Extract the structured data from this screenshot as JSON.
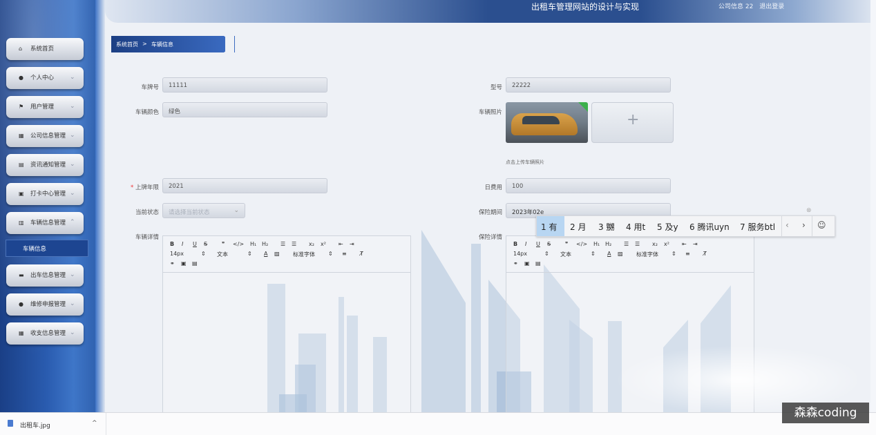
{
  "header": {
    "title": "出租车管理网站的设计与实现",
    "company_info": "公司信息 22",
    "logout": "退出登录"
  },
  "sidebar": {
    "items": [
      {
        "label": "系统首页",
        "icon": "home-icon",
        "glyph": "⌂"
      },
      {
        "label": "个人中心",
        "icon": "user-icon",
        "glyph": "●"
      },
      {
        "label": "用户管理",
        "icon": "flag-icon",
        "glyph": "⚑"
      },
      {
        "label": "公司信息管理",
        "icon": "grid-icon",
        "glyph": "▦"
      },
      {
        "label": "资讯通知管理",
        "icon": "news-icon",
        "glyph": "▤"
      },
      {
        "label": "打卡中心管理",
        "icon": "printer-icon",
        "glyph": "▣"
      },
      {
        "label": "车辆信息管理",
        "icon": "doc-icon",
        "glyph": "▥"
      },
      {
        "label": "出车信息管理",
        "icon": "monitor-icon",
        "glyph": "▬"
      },
      {
        "label": "维修申报管理",
        "icon": "user-icon",
        "glyph": "●"
      },
      {
        "label": "收支信息管理",
        "icon": "grid-icon",
        "glyph": "▦"
      }
    ],
    "active_sub": "车辆信息"
  },
  "breadcrumb": {
    "home": "系统首页",
    "sep": ">",
    "current": "车辆信息"
  },
  "form": {
    "plate_label": "车牌号",
    "plate_value": "11111",
    "model_label": "型号",
    "model_value": "22222",
    "color_label": "车辆颜色",
    "color_value": "绿色",
    "photo_label": "车辆照片",
    "photo_hint": "点击上传车辆照片",
    "upload_plus": "+",
    "year_required": "*",
    "year_label": "上牌年限",
    "year_value": "2021",
    "fee_label": "日费用",
    "fee_value": "100",
    "status_label": "当前状态",
    "status_placeholder": "请选择当前状态",
    "insurance_label": "保险期间",
    "insurance_value": "2023年02e",
    "detail_label": "车辆详情",
    "insurance_detail_label": "保险详情"
  },
  "editor_toolbar": {
    "bold": "B",
    "italic": "I",
    "underline": "U",
    "strike": "S",
    "quote": "❞",
    "code": "</>",
    "h1": "H₁",
    "h2": "H₂",
    "ol": "☰",
    "ul": "☰",
    "sub": "x₂",
    "sup": "x²",
    "outdent": "⇤",
    "indent": "⇥",
    "size": "14px",
    "type": "文本",
    "color": "A",
    "bg": "▨",
    "font": "标准字体",
    "align": "≡",
    "clear": "T̸",
    "link": "⚭",
    "image": "▣",
    "video": "▤"
  },
  "ime": {
    "candidates": [
      "1 有",
      "2 月",
      "3 嬲",
      "4 用t",
      "5 及y",
      "6 腾讯uyn",
      "7 服务btl"
    ],
    "prev": "‹",
    "next": "›",
    "emoji": "☺"
  },
  "download": {
    "file": "出租车.jpg",
    "chevron": "^"
  },
  "watermark": "森森coding"
}
